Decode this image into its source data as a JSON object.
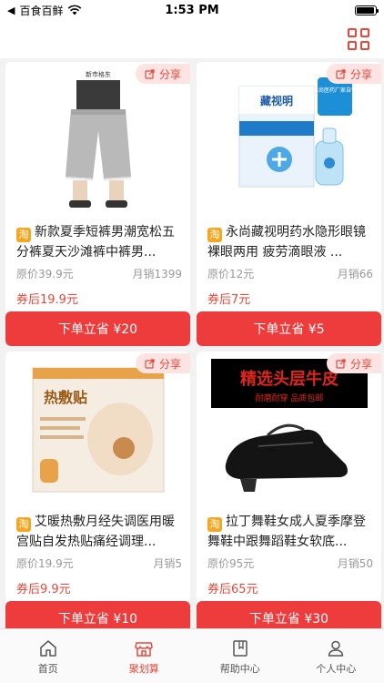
{
  "status_bar": {
    "back_label": "◀",
    "carrier": "百食百鲜",
    "time": "1:53 PM",
    "battery_level": 0.95
  },
  "nav": {
    "menu_icon": "grid-icon"
  },
  "products": [
    {
      "title": "新款夏季短裤男潮宽松五分裤夏天沙滩裤中裤男...",
      "platform_badge": "淘",
      "original_price": "原价39.9元",
      "monthly_sales": "月销1399",
      "coupon_price": "券后19.9元",
      "buy_label": "下单立省 ¥20",
      "share_label": "分享",
      "image_brand_text": "新市格东"
    },
    {
      "title": "永尚藏视明药水隐形眼镜裸眼两用 疲劳滴眼液 ...",
      "platform_badge": "淘",
      "original_price": "原价12元",
      "monthly_sales": "月销66",
      "coupon_price": "券后7元",
      "buy_label": "下单立省 ¥5",
      "share_label": "分享",
      "image_brand_text": "藏视明",
      "image_tag_text": "永尚医药厂家自营"
    },
    {
      "title": "艾暖热敷月经失调医用暖宫贴自发热贴痛经调理...",
      "platform_badge": "淘",
      "original_price": "原价19.9元",
      "monthly_sales": "月销5",
      "coupon_price": "券后9.9元",
      "buy_label": "下单立省 ¥10",
      "share_label": "分享",
      "image_brand_text": "热敷贴"
    },
    {
      "title": "拉丁舞鞋女成人夏季摩登舞鞋中跟舞蹈鞋女软底...",
      "platform_badge": "淘",
      "original_price": "原价95元",
      "monthly_sales": "月销50",
      "coupon_price": "券后65元",
      "buy_label": "下单立省 ¥30",
      "share_label": "分享",
      "image_banner_text": "精选头层牛皮",
      "image_sub_text": "耐磨耐穿 品质包邮"
    }
  ],
  "tabs": [
    {
      "label": "首页",
      "icon": "home-icon",
      "active": false
    },
    {
      "label": "聚划算",
      "icon": "store-icon",
      "active": true
    },
    {
      "label": "帮助中心",
      "icon": "book-icon",
      "active": false
    },
    {
      "label": "个人中心",
      "icon": "person-icon",
      "active": false
    }
  ],
  "colors": {
    "accent": "#ee3b3b",
    "share_bg": "#fde3e1",
    "badge": "#f5a623"
  }
}
